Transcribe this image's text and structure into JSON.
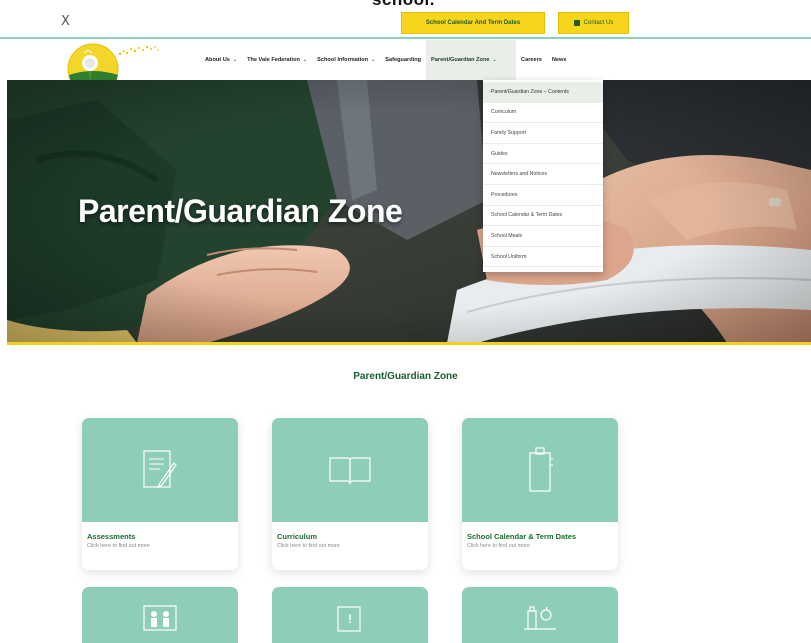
{
  "top_cut_text": "school.",
  "header": {
    "close_label": "X",
    "calendar_button": "School Calendar And Term Dates",
    "contact_button": "Contact Us"
  },
  "nav": {
    "items": [
      {
        "label": "About Us",
        "has_dropdown": true
      },
      {
        "label": "The Vale Federation",
        "has_dropdown": true
      },
      {
        "label": "School Information",
        "has_dropdown": true
      },
      {
        "label": "Safeguarding",
        "has_dropdown": false
      },
      {
        "label": "Parent/Guardian Zone",
        "has_dropdown": true
      },
      {
        "label": "Careers",
        "has_dropdown": false
      },
      {
        "label": "News",
        "has_dropdown": false
      }
    ],
    "chevron": "⌄"
  },
  "dropdown": {
    "items": [
      "Parent/Guardian Zone – Contents",
      "Curriculum",
      "Family Support",
      "Guides",
      "Newsletters and Notices",
      "Procedures",
      "School Calendar & Term Dates",
      "School Meals",
      "School Uniform"
    ]
  },
  "hero": {
    "title": "Parent/Guardian Zone"
  },
  "section": {
    "title": "Parent/Guardian Zone"
  },
  "cards": [
    {
      "title": "Assessments",
      "subtitle": "Click here to find out more",
      "icon": "notepad-pencil-icon"
    },
    {
      "title": "Curriculum",
      "subtitle": "Click here to find out more",
      "icon": "open-book-icon"
    },
    {
      "title": "School Calendar & Term Dates",
      "subtitle": "Click here to find out more",
      "icon": "calendar-icon"
    }
  ],
  "cards_row2": [
    {
      "icon": "family-icon"
    },
    {
      "icon": "notice-board-icon"
    },
    {
      "icon": "lunch-icon"
    }
  ],
  "colors": {
    "brand_green": "#1b5e2d",
    "accent_yellow": "#f7d51d",
    "card_mint": "#8ecdb8",
    "header_line": "#8ccfba"
  }
}
